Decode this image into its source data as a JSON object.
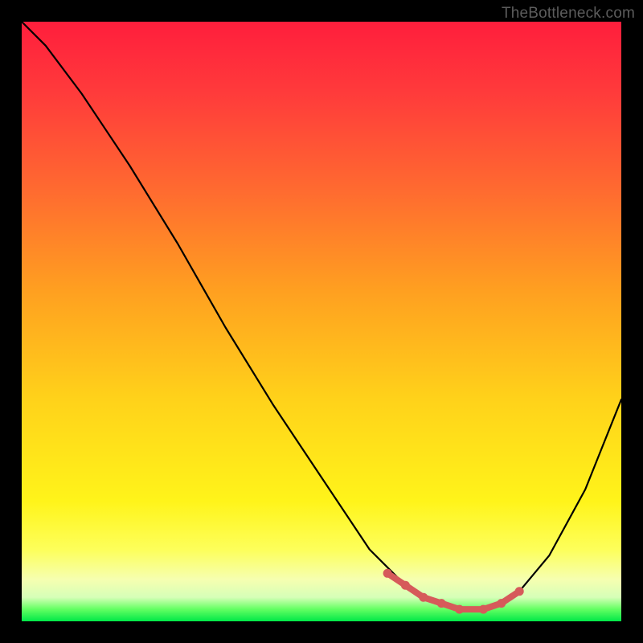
{
  "watermark": "TheBottleneck.com",
  "chart_data": {
    "type": "line",
    "title": "",
    "xlabel": "",
    "ylabel": "",
    "xlim": [
      0,
      100
    ],
    "ylim": [
      0,
      100
    ],
    "grid": false,
    "series": [
      {
        "name": "curve",
        "x": [
          0,
          4,
          10,
          18,
          26,
          34,
          42,
          50,
          58,
          63,
          67,
          72,
          78,
          83,
          88,
          94,
          100
        ],
        "y": [
          100,
          96,
          88,
          76,
          63,
          49,
          36,
          24,
          12,
          7,
          4,
          2,
          2,
          5,
          11,
          22,
          37
        ]
      }
    ],
    "markers": {
      "name": "trough-markers",
      "color": "#d65a5a",
      "x": [
        61,
        64,
        67,
        70,
        73,
        77,
        80,
        83
      ],
      "y": [
        8,
        6,
        4,
        3,
        2,
        2,
        3,
        5
      ]
    }
  }
}
